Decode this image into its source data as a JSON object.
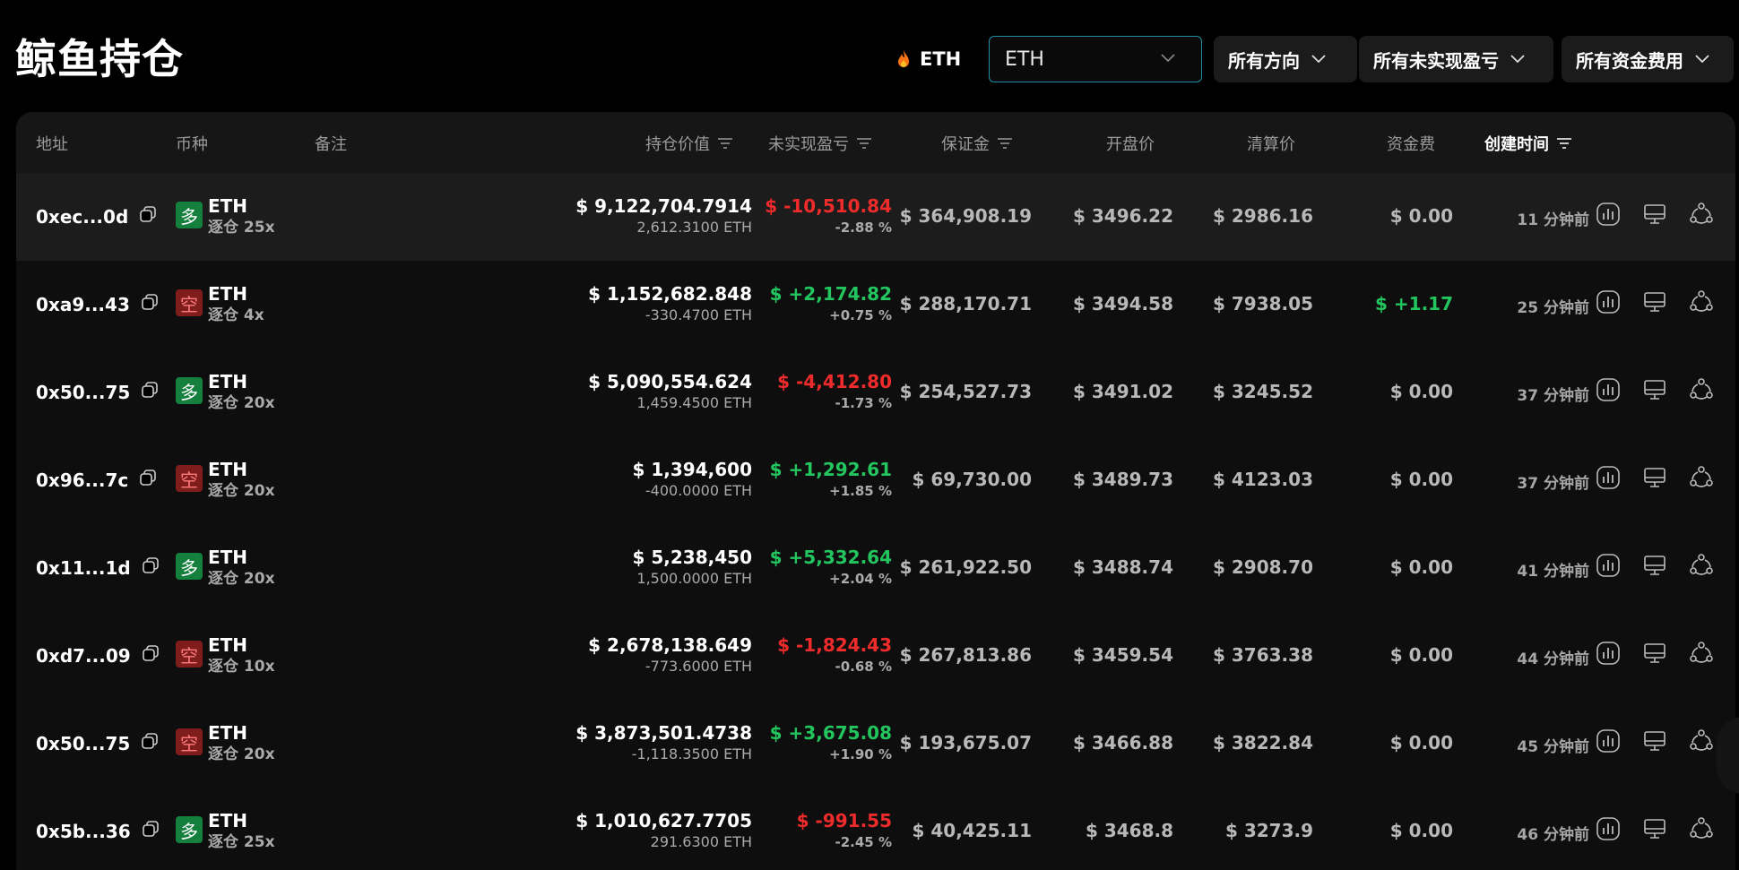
{
  "header": {
    "title": "鲸鱼持仓",
    "hot_coin": "ETH",
    "coin_select": {
      "value": "ETH"
    },
    "filters": [
      {
        "label": "所有方向"
      },
      {
        "label": "所有未实现盈亏"
      },
      {
        "label": "所有资金费用"
      }
    ]
  },
  "table": {
    "columns": {
      "address": "地址",
      "coin": "币种",
      "note": "备注",
      "position_value": "持仓价值",
      "unrealized_pnl": "未实现盈亏",
      "margin": "保证金",
      "open_price": "开盘价",
      "liq_price": "清算价",
      "funding": "资金费",
      "created": "创建时间"
    },
    "rows": [
      {
        "address": "0xec...0d",
        "side": "多",
        "coin": "ETH",
        "leverage": "逐仓 25x",
        "value": "$ 9,122,704.7914",
        "size": "2,612.3100 ETH",
        "pnl": "$ -10,510.84",
        "pnl_pct": "-2.88 %",
        "pnl_sign": "neg",
        "margin": "$ 364,908.19",
        "open": "$ 3496.22",
        "liq": "$ 2986.16",
        "funding": "$ 0.00",
        "funding_sign": "zero",
        "time": "11 分钟前"
      },
      {
        "address": "0xa9...43",
        "side": "空",
        "coin": "ETH",
        "leverage": "逐仓 4x",
        "value": "$ 1,152,682.848",
        "size": "-330.4700 ETH",
        "pnl": "$ +2,174.82",
        "pnl_pct": "+0.75 %",
        "pnl_sign": "pos",
        "margin": "$ 288,170.71",
        "open": "$ 3494.58",
        "liq": "$ 7938.05",
        "funding": "$ +1.17",
        "funding_sign": "pos",
        "time": "25 分钟前"
      },
      {
        "address": "0x50...75",
        "side": "多",
        "coin": "ETH",
        "leverage": "逐仓 20x",
        "value": "$ 5,090,554.624",
        "size": "1,459.4500 ETH",
        "pnl": "$ -4,412.80",
        "pnl_pct": "-1.73 %",
        "pnl_sign": "neg",
        "margin": "$ 254,527.73",
        "open": "$ 3491.02",
        "liq": "$ 3245.52",
        "funding": "$ 0.00",
        "funding_sign": "zero",
        "time": "37 分钟前"
      },
      {
        "address": "0x96...7c",
        "side": "空",
        "coin": "ETH",
        "leverage": "逐仓 20x",
        "value": "$ 1,394,600",
        "size": "-400.0000 ETH",
        "pnl": "$ +1,292.61",
        "pnl_pct": "+1.85 %",
        "pnl_sign": "pos",
        "margin": "$ 69,730.00",
        "open": "$ 3489.73",
        "liq": "$ 4123.03",
        "funding": "$ 0.00",
        "funding_sign": "zero",
        "time": "37 分钟前"
      },
      {
        "address": "0x11...1d",
        "side": "多",
        "coin": "ETH",
        "leverage": "逐仓 20x",
        "value": "$ 5,238,450",
        "size": "1,500.0000 ETH",
        "pnl": "$ +5,332.64",
        "pnl_pct": "+2.04 %",
        "pnl_sign": "pos",
        "margin": "$ 261,922.50",
        "open": "$ 3488.74",
        "liq": "$ 2908.70",
        "funding": "$ 0.00",
        "funding_sign": "zero",
        "time": "41 分钟前"
      },
      {
        "address": "0xd7...09",
        "side": "空",
        "coin": "ETH",
        "leverage": "逐仓 10x",
        "value": "$ 2,678,138.649",
        "size": "-773.6000 ETH",
        "pnl": "$ -1,824.43",
        "pnl_pct": "-0.68 %",
        "pnl_sign": "neg",
        "margin": "$ 267,813.86",
        "open": "$ 3459.54",
        "liq": "$ 3763.38",
        "funding": "$ 0.00",
        "funding_sign": "zero",
        "time": "44 分钟前"
      },
      {
        "address": "0x50...75",
        "side": "空",
        "coin": "ETH",
        "leverage": "逐仓 20x",
        "value": "$ 3,873,501.4738",
        "size": "-1,118.3500 ETH",
        "pnl": "$ +3,675.08",
        "pnl_pct": "+1.90 %",
        "pnl_sign": "pos",
        "margin": "$ 193,675.07",
        "open": "$ 3466.88",
        "liq": "$ 3822.84",
        "funding": "$ 0.00",
        "funding_sign": "zero",
        "time": "45 分钟前"
      },
      {
        "address": "0x5b...36",
        "side": "多",
        "coin": "ETH",
        "leverage": "逐仓 25x",
        "value": "$ 1,010,627.7705",
        "size": "291.6300 ETH",
        "pnl": "$ -991.55",
        "pnl_pct": "-2.45 %",
        "pnl_sign": "neg",
        "margin": "$ 40,425.11",
        "open": "$ 3468.8",
        "liq": "$ 3273.9",
        "funding": "$ 0.00",
        "funding_sign": "zero",
        "time": "46 分钟前"
      }
    ]
  },
  "colors": {
    "positive": "#22c55e",
    "negative": "#ef2b2b",
    "long_badge": "#15803d",
    "short_badge": "#7f1d1d",
    "select_border": "#1f8fa3"
  },
  "icons": {
    "flame": "flame-icon",
    "copy": "copy-icon",
    "chart": "chart-icon",
    "monitor": "monitor-icon",
    "share": "share-icon",
    "sort": "sort-icon",
    "chevron": "chevron-down-icon"
  }
}
